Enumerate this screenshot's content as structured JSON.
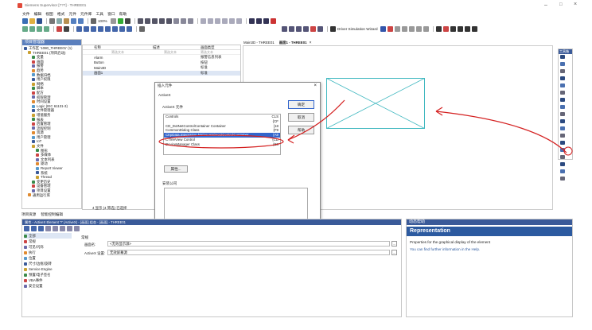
{
  "title_bar": {
    "title": "Siemens Supervisor [???] - THREE01",
    "min": "–",
    "max": "□",
    "close": "×"
  },
  "menu": [
    "文件",
    "编辑",
    "视图",
    "格式",
    "元件",
    "元件库",
    "工具",
    "窗口",
    "帮助"
  ],
  "toolbar": {
    "zoom": "100%",
    "driver_wizard": "Driver Simulation Wizard"
  },
  "project_panel": {
    "title": "项目管理器",
    "items": [
      {
        "label": "工作区 '1080_THREE01' (1)",
        "level": 0
      },
      {
        "label": "THREE01 (项目启动)",
        "level": 1
      },
      {
        "label": "变量",
        "level": 2
      },
      {
        "label": "画面",
        "level": 2
      },
      {
        "label": "报警",
        "level": 2
      },
      {
        "label": "趋势",
        "level": 2
      },
      {
        "label": "数据归档",
        "level": 2
      },
      {
        "label": "用户权限",
        "level": 2
      },
      {
        "label": "网络",
        "level": 2
      },
      {
        "label": "脚本",
        "level": 2
      },
      {
        "label": "配方",
        "level": 2
      },
      {
        "label": "权限管理",
        "level": 2
      },
      {
        "label": "时间设置",
        "level": 2
      },
      {
        "label": "Logic (IEC 61131-3)",
        "level": 2
      },
      {
        "label": "文件管理器",
        "level": 2
      },
      {
        "label": "增值服务",
        "level": 2
      },
      {
        "label": "报表",
        "level": 2
      },
      {
        "label": "后置管理",
        "level": 2
      },
      {
        "label": "流程控制",
        "level": 2
      },
      {
        "label": "资源",
        "level": 2
      },
      {
        "label": "用户管理",
        "level": 2
      },
      {
        "label": "IoT",
        "level": 2
      },
      {
        "label": "文件",
        "level": 2
      },
      {
        "label": "图形",
        "level": 3
      },
      {
        "label": "多媒体",
        "level": 3
      },
      {
        "label": "文本列表",
        "level": 3
      },
      {
        "label": "驱动",
        "level": 3
      },
      {
        "label": "Report Viewer",
        "level": 3
      },
      {
        "label": "系统",
        "level": 3
      },
      {
        "label": "Thread",
        "level": 3
      },
      {
        "label": "变更历史",
        "level": 2
      },
      {
        "label": "设备管理",
        "level": 2
      },
      {
        "label": "项目设置",
        "level": 2
      },
      {
        "label": "通用运行库",
        "level": 1
      }
    ],
    "tabs": [
      "项目资源",
      "智能控制编辑"
    ]
  },
  "screen_list": {
    "col_name": "名称",
    "col_desc": "描述",
    "col_type": "画面类型",
    "filter_placeholder": "筛选文本",
    "rows": [
      {
        "name": "Alarm",
        "type": "报警信息列表"
      },
      {
        "name": "Button",
        "type": "按钮"
      },
      {
        "name": "Main3D",
        "type": "标准"
      },
      {
        "name": "画面1",
        "type": "标准"
      }
    ],
    "status": "4 显示 (4 筛选) 已选择"
  },
  "doc_tabs": [
    "Main3D - THREE01",
    "画面1 - THREE01"
  ],
  "dialog": {
    "title": "插入元件",
    "close": "×",
    "category": "ActiveX",
    "group": "ActiveX 元件",
    "list_header": "Controls",
    "items": [
      {
        "name": "",
        "code": "CLS"
      },
      {
        "name": "",
        "code": "{CF"
      },
      {
        "name": "CD_DotNetControlContainer Container",
        "code": "{18"
      },
      {
        "name": "CommonDialog Class",
        "code": "{F9"
      },
      {
        "name": "CtrpData.Integration.Native.HmiHostControlContainer",
        "code": "{A9"
      },
      {
        "name": "CTreeView Control",
        "code": "{CD"
      },
      {
        "name": "DeviceManager Class",
        "code": "{E8"
      }
    ],
    "selected_index": 4,
    "properties_btn": "属性...",
    "install_label": "安装公司",
    "ok": "确定",
    "cancel": "取消",
    "help": "帮助",
    "install_btn": "安装...",
    "down_btn": "下移",
    "up_btn": "上移"
  },
  "properties_panel": {
    "title": "属性 - ActiveX Element '?' (ActiveX) - [画面] 组态 - [画面] - THREE01",
    "categories": [
      "全部",
      "常规",
      "可见/闪烁",
      "执行",
      "位置",
      "尺寸/边框/旋转",
      "Service Engine",
      "预置/电子签名",
      "VBA事件",
      "安全设置"
    ],
    "section": "常规",
    "field1_label": "画面名:",
    "field1_value": "<无效显示源>",
    "field2_label": "ActiveX 设置:",
    "field2_value": "无效屏幕源"
  },
  "help_panel": {
    "title": "动态帮助",
    "heading": "Representation",
    "line1": "Properties for the graphical display of the element",
    "line2": "You can find further information in the Help."
  },
  "toolbox": {
    "title": "工具箱"
  },
  "colors": {
    "accent_blue": "#3a5a99",
    "annotation_red": "#d42020",
    "selection_blue": "#3366cc",
    "teal_placeholder": "#40b8c0"
  }
}
